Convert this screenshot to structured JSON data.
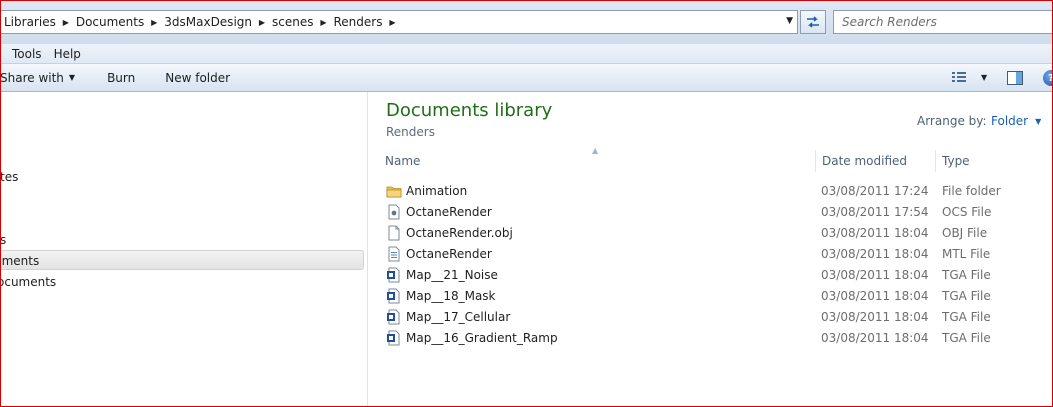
{
  "address": {
    "crumbs": [
      "Libraries",
      "Documents",
      "3dsMaxDesign",
      "scenes",
      "Renders"
    ],
    "search_placeholder": "Search Renders"
  },
  "menu": {
    "items": [
      "Tools",
      "Help"
    ]
  },
  "commands": {
    "share_with": "Share with",
    "burn": "Burn",
    "new_folder": "New folder"
  },
  "nav": {
    "items": [
      {
        "label": "tes"
      },
      {
        "label": "s"
      },
      {
        "label": "uments"
      },
      {
        "label": "ocuments"
      }
    ]
  },
  "content": {
    "title": "Documents library",
    "subtitle": "Renders",
    "arrange_label": "Arrange by:",
    "arrange_value": "Folder",
    "columns": [
      "Name",
      "Date modified",
      "Type"
    ],
    "files": [
      {
        "name": "Animation",
        "date": "03/08/2011 17:24",
        "type": "File folder",
        "icon": "folder-icon"
      },
      {
        "name": "OctaneRender",
        "date": "03/08/2011 17:54",
        "type": "OCS File",
        "icon": "ocs-file-icon"
      },
      {
        "name": "OctaneRender.obj",
        "date": "03/08/2011 18:04",
        "type": "OBJ File",
        "icon": "blank-file-icon"
      },
      {
        "name": "OctaneRender",
        "date": "03/08/2011 18:04",
        "type": "MTL File",
        "icon": "mtl-file-icon"
      },
      {
        "name": "Map__21_Noise",
        "date": "03/08/2011 18:04",
        "type": "TGA File",
        "icon": "tga-file-icon"
      },
      {
        "name": "Map__18_Mask",
        "date": "03/08/2011 18:04",
        "type": "TGA File",
        "icon": "tga-file-icon"
      },
      {
        "name": "Map__17_Cellular",
        "date": "03/08/2011 18:04",
        "type": "TGA File",
        "icon": "tga-file-icon"
      },
      {
        "name": "Map__16_Gradient_Ramp",
        "date": "03/08/2011 18:04",
        "type": "TGA File",
        "icon": "tga-file-icon"
      }
    ]
  }
}
